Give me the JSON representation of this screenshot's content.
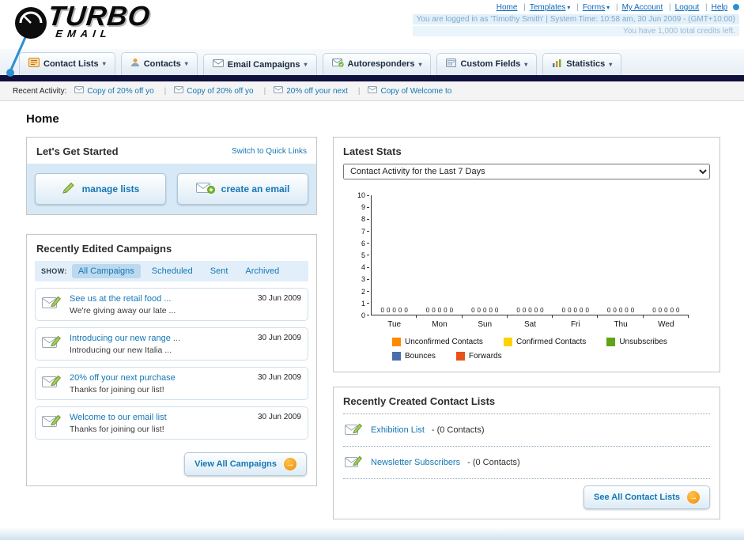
{
  "icons": {
    "chevron_down": "▾",
    "arrow_right": "→"
  },
  "header": {
    "logo_title": "TURBO",
    "logo_subtitle": "EMAIL",
    "nav": {
      "home": "Home",
      "templates": "Templates",
      "forms": "Forms",
      "my_account": "My Account",
      "logout": "Logout",
      "help": "Help"
    },
    "login_info": "You are logged in as 'Timothy Smith' | System Time: 10:58 am, 30 Jun 2009 - (GMT+10:00)",
    "credits_info": "You have 1,000 total credits left."
  },
  "main_nav": {
    "items": [
      {
        "label": "Contact Lists",
        "icon": "contact-lists-icon"
      },
      {
        "label": "Contacts",
        "icon": "contacts-icon"
      },
      {
        "label": "Email Campaigns",
        "icon": "email-campaigns-icon"
      },
      {
        "label": "Autoresponders",
        "icon": "autoresponders-icon"
      },
      {
        "label": "Custom Fields",
        "icon": "custom-fields-icon"
      },
      {
        "label": "Statistics",
        "icon": "statistics-icon"
      }
    ]
  },
  "recent_activity": {
    "label": "Recent Activity:",
    "items": [
      {
        "label": "Copy of 20% off yo"
      },
      {
        "label": "Copy of 20% off yo"
      },
      {
        "label": "20% off your next"
      },
      {
        "label": "Copy of Welcome to"
      }
    ]
  },
  "page_title": "Home",
  "get_started": {
    "title": "Let's Get Started",
    "switch_link": "Switch to Quick Links",
    "manage_lists_label": "manage lists",
    "create_email_label": "create an email"
  },
  "campaigns": {
    "title": "Recently Edited Campaigns",
    "show_label": "SHOW:",
    "tabs": [
      {
        "label": "All Campaigns",
        "active": true
      },
      {
        "label": "Scheduled",
        "active": false
      },
      {
        "label": "Sent",
        "active": false
      },
      {
        "label": "Archived",
        "active": false
      }
    ],
    "items": [
      {
        "title": "See us at the retail food ...",
        "subtitle": "We're giving away our late ...",
        "date": "30 Jun 2009"
      },
      {
        "title": "Introducing our new range ...",
        "subtitle": "Introducing our new Italia ...",
        "date": "30 Jun 2009"
      },
      {
        "title": "20% off your next purchase",
        "subtitle": "Thanks for joining our list!",
        "date": "30 Jun 2009"
      },
      {
        "title": "Welcome to our email list",
        "subtitle": "Thanks for joining our list!",
        "date": "30 Jun 2009"
      }
    ],
    "view_all_label": "View All Campaigns"
  },
  "stats": {
    "title": "Latest Stats",
    "period_selector": "Contact Activity for the Last 7 Days",
    "chart_data": {
      "type": "bar",
      "categories": [
        "Tue",
        "Mon",
        "Sun",
        "Sat",
        "Fri",
        "Thu",
        "Wed"
      ],
      "series": [
        {
          "name": "Unconfirmed Contacts",
          "color": "#FF8A00",
          "values": [
            0,
            0,
            0,
            0,
            0,
            0,
            0
          ]
        },
        {
          "name": "Confirmed Contacts",
          "color": "#FFD200",
          "values": [
            0,
            0,
            0,
            0,
            0,
            0,
            0
          ]
        },
        {
          "name": "Unsubscribes",
          "color": "#61A317",
          "values": [
            0,
            0,
            0,
            0,
            0,
            0,
            0
          ]
        },
        {
          "name": "Bounces",
          "color": "#4A6EA9",
          "values": [
            0,
            0,
            0,
            0,
            0,
            0,
            0
          ]
        },
        {
          "name": "Forwards",
          "color": "#E8521A",
          "values": [
            0,
            0,
            0,
            0,
            0,
            0,
            0
          ]
        }
      ],
      "ylim": [
        0,
        10
      ],
      "ytick_step": 1,
      "grid": false,
      "legend_position": "bottom"
    }
  },
  "contact_lists": {
    "title": "Recently Created Contact Lists",
    "items": [
      {
        "name": "Exhibition List",
        "detail": "- (0 Contacts)"
      },
      {
        "name": "Newsletter Subscribers",
        "detail": "- (0 Contacts)"
      }
    ],
    "see_all_label": "See All Contact Lists"
  }
}
